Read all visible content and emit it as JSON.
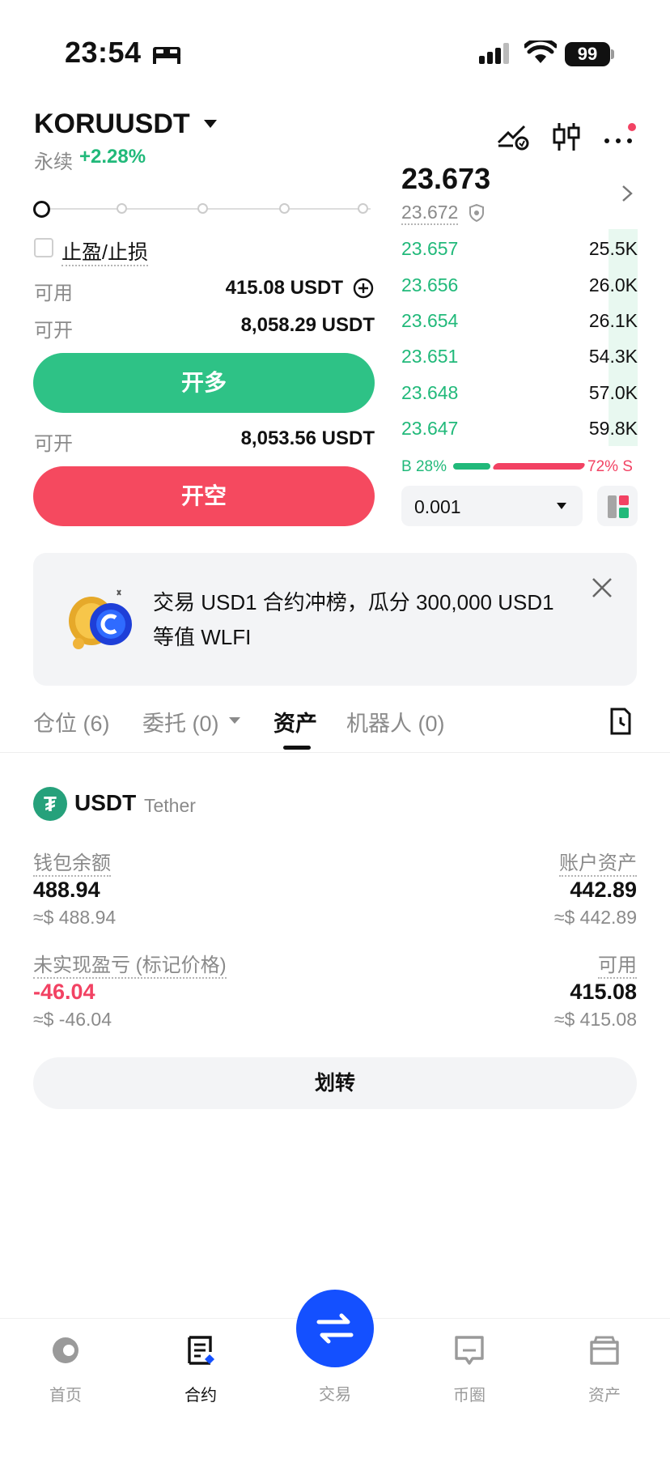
{
  "status_bar": {
    "time": "23:54",
    "battery": "99"
  },
  "header": {
    "pair": "KORUUSDT",
    "contract_type": "永续",
    "change": "+2.28%"
  },
  "order_form": {
    "tpsl_label": "止盈/止损",
    "available_label": "可用",
    "available_value": "415.08 USDT",
    "open_long_label": "可开",
    "open_long_value": "8,058.29 USDT",
    "long_button": "开多",
    "open_short_label": "可开",
    "open_short_value": "8,053.56 USDT",
    "short_button": "开空",
    "leverage_slider_level": 0
  },
  "order_book": {
    "last_price": "23.673",
    "mark_price": "23.672",
    "bids": [
      {
        "price": "23.657",
        "qty": "25.5K"
      },
      {
        "price": "23.656",
        "qty": "26.0K"
      },
      {
        "price": "23.654",
        "qty": "26.1K"
      },
      {
        "price": "23.651",
        "qty": "54.3K"
      },
      {
        "price": "23.648",
        "qty": "57.0K"
      },
      {
        "price": "23.647",
        "qty": "59.8K"
      }
    ],
    "buy_ratio": "B 28%",
    "sell_ratio": "72% S",
    "precision": "0.001"
  },
  "banner": {
    "text": "交易 USD1 合约冲榜，瓜分 300,000 USD1 等值 WLFI"
  },
  "tabs": {
    "positions": "仓位 (6)",
    "orders": "委托 (0)",
    "assets": "资产",
    "bots": "机器人 (0)"
  },
  "asset": {
    "coin": "USDT",
    "coin_full": "Tether",
    "wallet_balance_label": "钱包余额",
    "wallet_balance": "488.94",
    "wallet_balance_usd": "≈$ 488.94",
    "account_equity_label": "账户资产",
    "account_equity": "442.89",
    "account_equity_usd": "≈$ 442.89",
    "unrealized_pnl_label": "未实现盈亏 (标记价格)",
    "unrealized_pnl": "-46.04",
    "unrealized_pnl_usd": "≈$ -46.04",
    "available_label": "可用",
    "available": "415.08",
    "available_usd": "≈$ 415.08",
    "transfer_button": "划转"
  },
  "bottom_nav": {
    "home": "首页",
    "contract": "合约",
    "trade": "交易",
    "community": "币圈",
    "assets": "资产"
  },
  "colors": {
    "green": "#21b97a",
    "red": "#f24263",
    "accent": "#1450ff"
  }
}
